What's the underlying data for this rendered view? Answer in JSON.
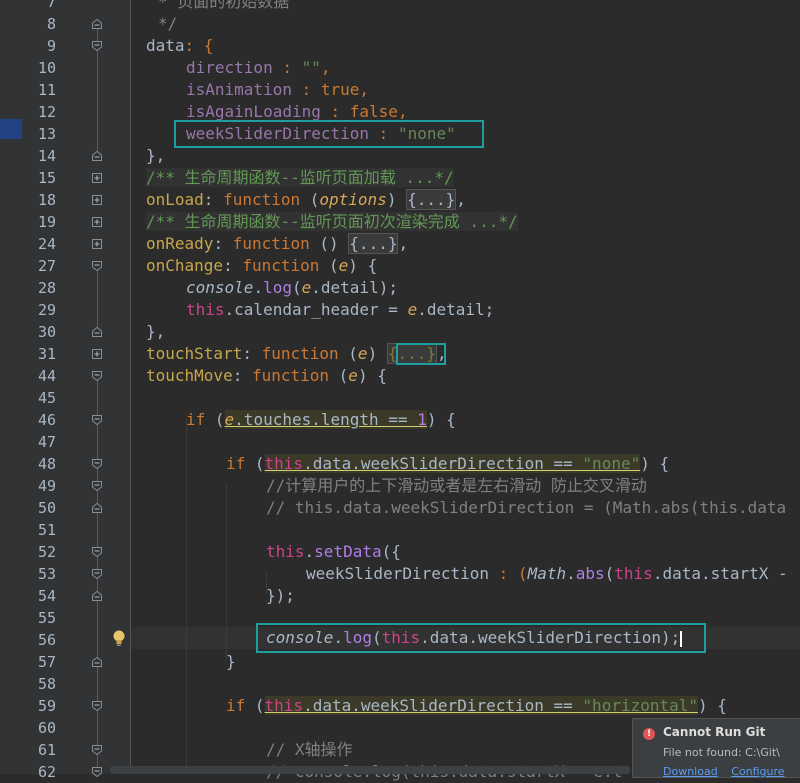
{
  "editor": {
    "line_numbers": [
      "7",
      "8",
      "9",
      "10",
      "11",
      "12",
      "13",
      "14",
      "15",
      "18",
      "19",
      "24",
      "27",
      "28",
      "29",
      "30",
      "31",
      "44",
      "45",
      "46",
      "47",
      "48",
      "49",
      "50",
      "51",
      "52",
      "53",
      "54",
      "55",
      "56",
      "57",
      "58",
      "59",
      "60",
      "61",
      "62"
    ],
    "text": {
      "l7": "* 页面的初始数据",
      "l8": "*/",
      "l9_key": "data",
      "l9_rest": ": {",
      "l10_key": "direction",
      "l10_sep": " : ",
      "l10_val": "\"\"",
      "l10_end": ",",
      "l11_key": "isAnimation",
      "l11_sep": " : ",
      "l11_val": "true",
      "l11_end": ",",
      "l12_key": "isAgainLoading",
      "l12_sep": " : ",
      "l12_val": "false",
      "l12_end": ",",
      "l13_key": "weekSliderDirection",
      "l13_sep": " : ",
      "l13_val": "\"none\"",
      "l14": "},",
      "l15": "/** 生命周期函数--监听页面加载 ...*/",
      "l18_key": "onLoad",
      "l18_sep": ": ",
      "l18_fn": "function",
      "l18_p1": " (",
      "l18_param": "options",
      "l18_p2": ") ",
      "l18_fold": "{...}",
      "l18_end": ",",
      "l19": "/** 生命周期函数--监听页面初次渲染完成 ...*/",
      "l24_key": "onReady",
      "l24_sep": ": ",
      "l24_fn": "function",
      "l24_p": " () ",
      "l24_fold": "{...}",
      "l24_end": ",",
      "l27_key": "onChange",
      "l27_sep": ": ",
      "l27_fn": "function",
      "l27_p1": " (",
      "l27_param": "e",
      "l27_p2": ") {",
      "l28_obj": "console",
      "l28_dot": ".",
      "l28_call": "log",
      "l28_p1": "(",
      "l28_e": "e",
      "l28_p2": ".detail);",
      "l29_this": "this",
      "l29_a": ".calendar_header = ",
      "l29_e": "e",
      "l29_b": ".detail;",
      "l30": "},",
      "l31_key": "touchStart",
      "l31_sep": ": ",
      "l31_fn": "function",
      "l31_p1": " (",
      "l31_param": "e",
      "l31_p2": ") ",
      "l31_fold": "{...}",
      "l31_end": ",",
      "l44_key": "touchMove",
      "l44_sep": ": ",
      "l44_fn": "function",
      "l44_p1": " (",
      "l44_param": "e",
      "l44_p2": ") {",
      "l46_if": "if",
      "l46_a": " (",
      "l46_e": "e",
      "l46_cond": ".touches.length == ",
      "l46_num": "1",
      "l46_b": ") {",
      "l48_if": "if",
      "l48_a": " (",
      "l48_this": "this",
      "l48_cond": ".data.weekSliderDirection == ",
      "l48_str": "\"none\"",
      "l48_b": ") {",
      "l49": "//计算用户的上下滑动或者是左右滑动 防止交叉滑动",
      "l50": "// this.data.weekSliderDirection = (Math.abs(this.data",
      "l52_this": "this",
      "l52_dot": ".",
      "l52_call": "setData",
      "l52_b": "({",
      "l53_key": "weekSliderDirection",
      "l53_a": " : (",
      "l53_math": "Math",
      "l53_dot": ".",
      "l53_call": "abs",
      "l53_b": "(",
      "l53_this": "this",
      "l53_c": ".data.startX -",
      "l54": "});",
      "l56_obj": "console",
      "l56_dot": ".",
      "l56_call": "log",
      "l56_a": "(",
      "l56_this": "this",
      "l56_b": ".data.weekSliderDirection);",
      "l57": "}",
      "l59_if": "if",
      "l59_a": " (",
      "l59_this": "this",
      "l59_cond": ".data.weekSliderDirection == ",
      "l59_str": "\"horizontal\"",
      "l59_b": ") {",
      "l61": "// X轴操作",
      "l62": "// console.log(this.data.startX - e.t"
    }
  },
  "notification": {
    "title": "Cannot Run Git",
    "message": "File not found: C:\\Git\\",
    "link_download": "Download",
    "link_configure": "Configure"
  },
  "colors": {
    "background": "#2b2b2b",
    "gutter": "#313335",
    "highlight_box": "#1e9e9e"
  }
}
